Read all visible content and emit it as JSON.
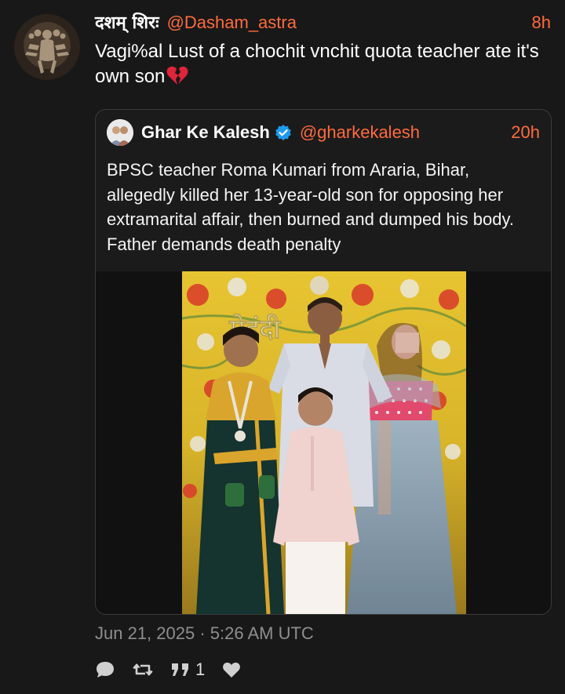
{
  "post": {
    "author": {
      "display_name": "दशम् शिरः",
      "handle": "@Dasham_astra"
    },
    "time": "8h",
    "text": "Vagi%al Lust of a chochit vnchit quota teacher ate it's own son",
    "emoji": "broken-heart",
    "timestamp": "Jun 21, 2025 · 5:26 AM UTC"
  },
  "quoted": {
    "author": {
      "display_name": "Ghar Ke Kalesh",
      "handle": "@gharkekalesh",
      "verified": true
    },
    "time": "20h",
    "text": "BPSC teacher Roma Kumari from Araria, Bihar, allegedly killed her 13-year-old son for opposing her extramarital affair, then burned and dumped his body. Father demands death penalty",
    "media": {
      "type": "photo",
      "sign_text": "मेहंदी"
    }
  },
  "actions": {
    "reply_icon": "speech-bubble-icon",
    "retweet_icon": "retweet-icon",
    "quote_icon": "quote-icon",
    "quote_count": "1",
    "like_icon": "heart-icon"
  },
  "colors": {
    "accent": "#ff6b3d",
    "background": "#181818",
    "muted": "#8e8e8e",
    "verified": "#1d9bf0"
  }
}
